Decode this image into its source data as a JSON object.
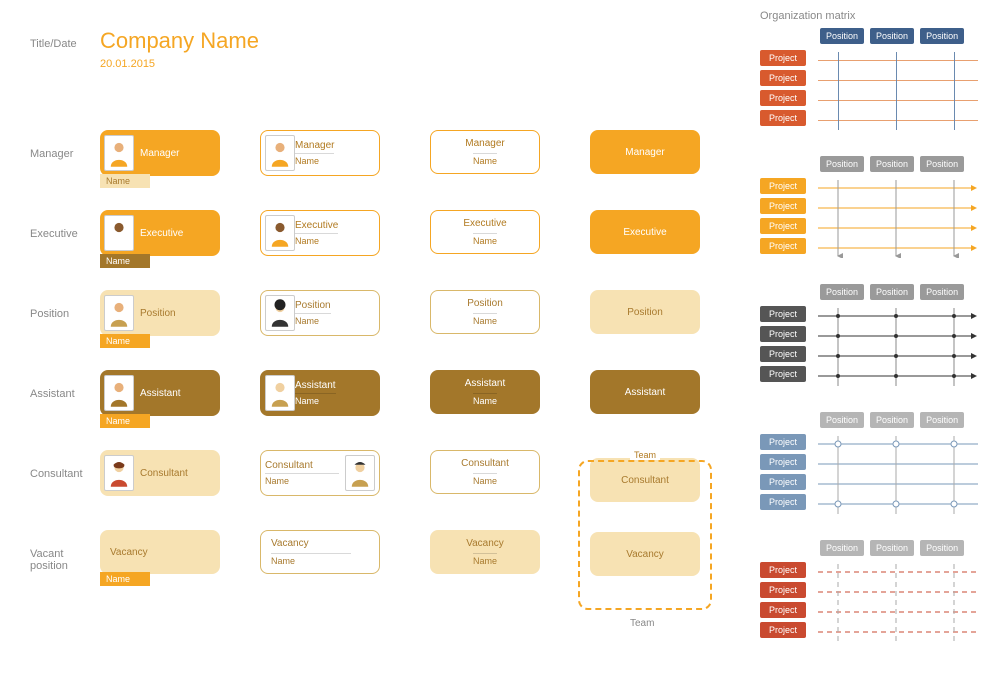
{
  "title_section": {
    "label": "Title/Date",
    "company": "Company Name",
    "date": "20.01.2015"
  },
  "rows": [
    {
      "label": "Manager",
      "role": "Manager",
      "name": "Name"
    },
    {
      "label": "Executive",
      "role": "Executive",
      "name": "Name"
    },
    {
      "label": "Position",
      "role": "Position",
      "name": "Name"
    },
    {
      "label": "Assistant",
      "role": "Assistant",
      "name": "Name"
    },
    {
      "label": "Consultant",
      "role": "Consultant",
      "name": "Name"
    },
    {
      "label": "Vacant position",
      "role": "Vacancy",
      "name": "Name"
    }
  ],
  "team_label": "Team",
  "right": {
    "title": "Organization matrix",
    "position_label": "Position",
    "project_label": "Project"
  }
}
